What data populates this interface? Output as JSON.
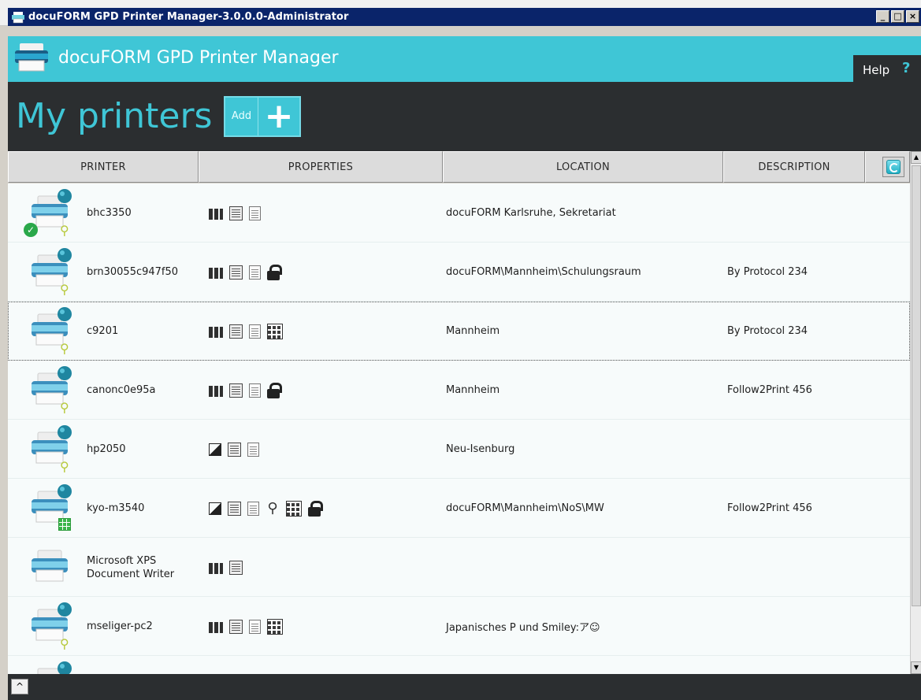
{
  "window": {
    "title": "docuFORM GPD Printer Manager-3.0.0.0-Administrator",
    "minimize_label": "_",
    "restore_label": "□",
    "close_label": "×"
  },
  "header": {
    "app_name": "docuFORM GPD Printer Manager",
    "help_label": "Help",
    "help_icon": "?",
    "accent_color": "#3fc6d6"
  },
  "page": {
    "title": "My printers",
    "add_label": "Add",
    "add_icon": "+"
  },
  "table": {
    "columns": [
      "PRINTER",
      "PROPERTIES",
      "LOCATION",
      "DESCRIPTION"
    ],
    "rows": [
      {
        "name": "bhc3350",
        "properties": [
          "color-icon",
          "duplex-icon",
          "paper-icon"
        ],
        "location": "docuFORM Karlsruhe, Sekretariat",
        "description": "",
        "status": "default-checkmark-icon",
        "badge": "user-icon"
      },
      {
        "name": "brn30055c947f50",
        "properties": [
          "color-icon",
          "duplex-icon",
          "paper-icon",
          "lock-icon"
        ],
        "location": "docuFORM\\Mannheim\\Schulungsraum",
        "description": "By Protocol 234",
        "badge": "user-icon"
      },
      {
        "name": "c9201",
        "properties": [
          "color-icon",
          "duplex-icon",
          "paper-icon",
          "grid-icon"
        ],
        "location": "Mannheim",
        "description": "By Protocol 234",
        "badge": "user-icon",
        "selected": true
      },
      {
        "name": "canonc0e95a",
        "properties": [
          "color-icon",
          "duplex-icon",
          "paper-icon",
          "lock-icon"
        ],
        "location": "Mannheim",
        "description": "Follow2Print 456",
        "badge": "user-icon"
      },
      {
        "name": "hp2050",
        "properties": [
          "bw-icon",
          "duplex-icon",
          "paper-icon"
        ],
        "location": "Neu-Isenburg",
        "description": "",
        "badge": "user-icon"
      },
      {
        "name": "kyo-m3540",
        "properties": [
          "bw-icon",
          "duplex-icon",
          "paper-icon",
          "user-icon",
          "grid-icon",
          "lock-icon"
        ],
        "location": "docuFORM\\Mannheim\\NoS\\MW",
        "description": "Follow2Print 456",
        "badge": "grid-badge-icon"
      },
      {
        "name": "Microsoft XPS Document Writer",
        "properties": [
          "color-icon",
          "duplex-icon"
        ],
        "location": "",
        "description": "",
        "badge": ""
      },
      {
        "name": "mseliger-pc2",
        "properties": [
          "color-icon",
          "duplex-icon",
          "paper-icon",
          "grid-icon"
        ],
        "location": "Japanisches P und Smiley:ア☺",
        "description": "",
        "badge": "user-icon"
      },
      {
        "name": "",
        "properties": [],
        "location": "",
        "description": "",
        "badge": ""
      }
    ]
  },
  "footer": {
    "collapse_icon": "^"
  }
}
